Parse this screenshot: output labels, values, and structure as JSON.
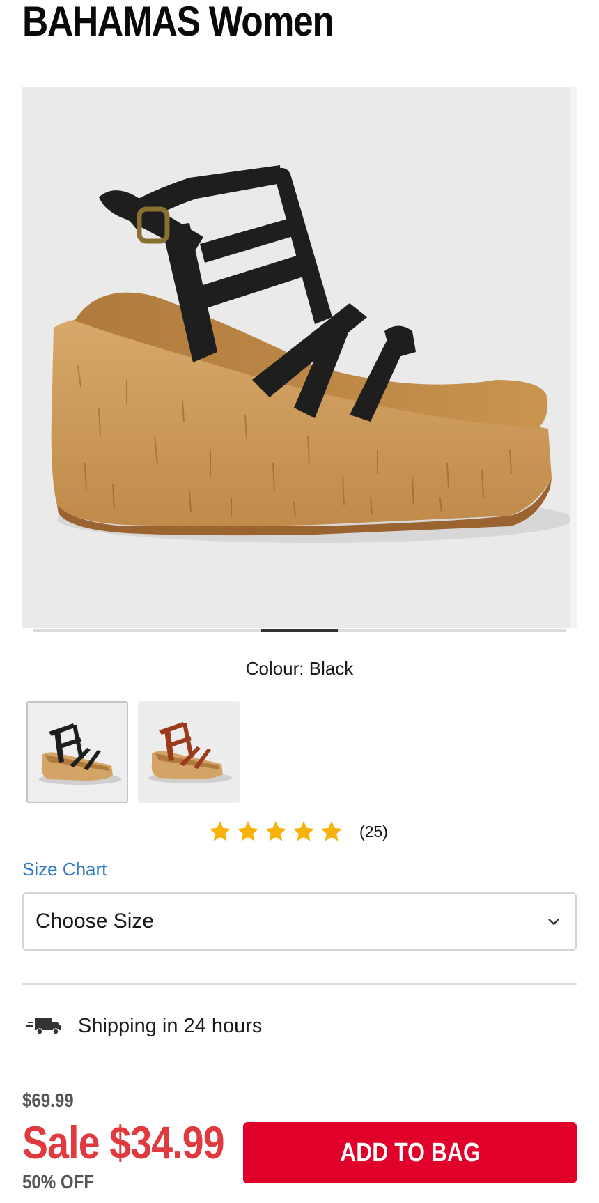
{
  "product": {
    "title": "BAHAMAS Women",
    "image_alt": "Black cork wedge sandal"
  },
  "gallery": {
    "slide_count": 7,
    "active_slide": 4
  },
  "colour": {
    "label": "Colour: Black",
    "swatches": [
      {
        "name": "Black",
        "selected": true
      },
      {
        "name": "Cognac",
        "selected": false
      }
    ]
  },
  "rating": {
    "stars": 5,
    "count": "(25)",
    "star_color": "#f7b20c"
  },
  "size": {
    "chart_link": "Size Chart",
    "select_label": "Choose Size"
  },
  "shipping": {
    "text": "Shipping in 24 hours",
    "icon": "truck-icon"
  },
  "price": {
    "original": "$69.99",
    "sale": "Sale $34.99",
    "discount": "50% OFF"
  },
  "cta": {
    "add_to_bag": "ADD TO BAG",
    "color": "#e0002a"
  },
  "colors": {
    "link": "#2f79c8",
    "sale": "#e03a3e"
  }
}
